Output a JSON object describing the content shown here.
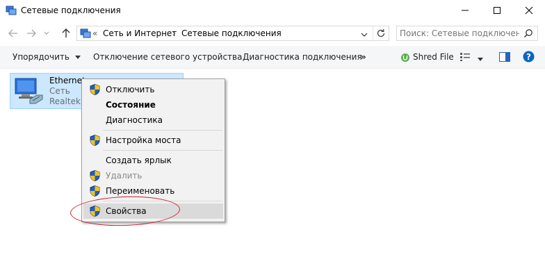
{
  "window": {
    "title": "Сетевые подключения"
  },
  "address": {
    "chevron": "«",
    "crumbs": [
      "Сеть и Интернет",
      "Сетевые подключения"
    ],
    "separator": "›"
  },
  "search": {
    "placeholder": "Поиск: Сетевые подключения"
  },
  "toolbar": {
    "organize": "Упорядочить",
    "disable_device": "Отключение сетевого устройства",
    "diagnose": "Диагностика подключения",
    "more": "»",
    "shred": "Shred File"
  },
  "connection": {
    "name": "Ethernet",
    "network": "Сеть",
    "adapter": "Realtek P"
  },
  "context_menu": {
    "items": [
      {
        "label": "Отключить",
        "shield": true,
        "bold": false,
        "disabled": false
      },
      {
        "label": "Состояние",
        "shield": false,
        "bold": true,
        "disabled": false
      },
      {
        "label": "Диагностика",
        "shield": false,
        "bold": false,
        "disabled": false
      },
      {
        "label": "Настройка моста",
        "shield": true,
        "bold": false,
        "disabled": false
      },
      {
        "label": "Создать ярлык",
        "shield": false,
        "bold": false,
        "disabled": false
      },
      {
        "label": "Удалить",
        "shield": true,
        "bold": false,
        "disabled": true
      },
      {
        "label": "Переименовать",
        "shield": true,
        "bold": false,
        "disabled": false
      },
      {
        "label": "Свойства",
        "shield": true,
        "bold": false,
        "disabled": false,
        "highlighted": true
      }
    ]
  },
  "colors": {
    "selection": "#cce8ff",
    "annotation": "#d11f2c",
    "help": "#0a66c2"
  },
  "icons": [
    "network-connections-app-icon",
    "minimize-icon",
    "maximize-icon",
    "close-icon",
    "back-arrow-icon",
    "forward-arrow-icon",
    "up-arrow-icon",
    "refresh-icon",
    "search-icon",
    "shred-file-icon",
    "view-options-icon",
    "preview-pane-icon",
    "help-icon",
    "ethernet-adapter-icon",
    "uac-shield-icon"
  ]
}
